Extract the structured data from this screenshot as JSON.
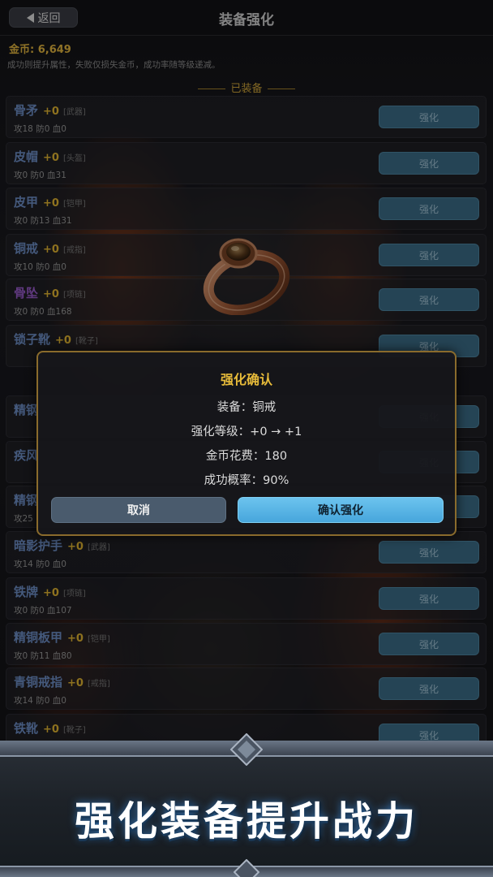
{
  "header": {
    "back_label": "返回",
    "title": "装备强化"
  },
  "gold_text": "金币: 6,649",
  "rule_text": "成功则提升属性，失败仅损失金币，成功率随等级递减。",
  "equipped_section": "已装备",
  "enhance_button_label": "强化",
  "items": [
    {
      "name": "骨矛",
      "level": "+0",
      "slot": "[武器]",
      "stats": "攻18 防0 血0",
      "color": "#6f90c9"
    },
    {
      "name": "皮帽",
      "level": "+0",
      "slot": "[头盔]",
      "stats": "攻0 防0 血31",
      "color": "#6f90c9"
    },
    {
      "name": "皮甲",
      "level": "+0",
      "slot": "[铠甲]",
      "stats": "攻0 防13 血31",
      "color": "#6f90c9"
    },
    {
      "name": "铜戒",
      "level": "+0",
      "slot": "[戒指]",
      "stats": "攻10 防0 血0",
      "color": "#6f90c9"
    },
    {
      "name": "骨坠",
      "level": "+0",
      "slot": "[项链]",
      "stats": "攻0 防0 血168",
      "color": "#9b5ccf"
    },
    {
      "name": "锁子靴",
      "level": "+0",
      "slot": "[靴子]",
      "stats": "",
      "color": "#6f90c9"
    },
    {
      "name": "精钢",
      "level": "",
      "slot": "",
      "stats": "",
      "color": "#6f90c9"
    },
    {
      "name": "疾风",
      "level": "",
      "slot": "",
      "stats": "",
      "color": "#6f90c9"
    },
    {
      "name": "精钢",
      "level": "",
      "slot": "",
      "stats": "攻25",
      "color": "#6f90c9"
    },
    {
      "name": "暗影护手",
      "level": "+0",
      "slot": "[武器]",
      "stats": "攻14 防0 血0",
      "color": "#6f90c9"
    },
    {
      "name": "铁牌",
      "level": "+0",
      "slot": "[项链]",
      "stats": "攻0 防0 血107",
      "color": "#6f90c9"
    },
    {
      "name": "精铜板甲",
      "level": "+0",
      "slot": "[铠甲]",
      "stats": "攻0 防11 血80",
      "color": "#6f90c9"
    },
    {
      "name": "青铜戒指",
      "level": "+0",
      "slot": "[戒指]",
      "stats": "攻14 防0 血0",
      "color": "#6f90c9"
    },
    {
      "name": "铁靴",
      "level": "+0",
      "slot": "[靴子]",
      "stats": "",
      "color": "#6f90c9"
    }
  ],
  "dialog": {
    "title": "强化确认",
    "equipment": "装备：铜戒",
    "level_change": "强化等级：+0 → +1",
    "cost": "金币花费：180",
    "success_rate": "成功概率：90%",
    "cancel_label": "取消",
    "confirm_label": "确认强化"
  },
  "banner_text": "强化装备提升战力"
}
